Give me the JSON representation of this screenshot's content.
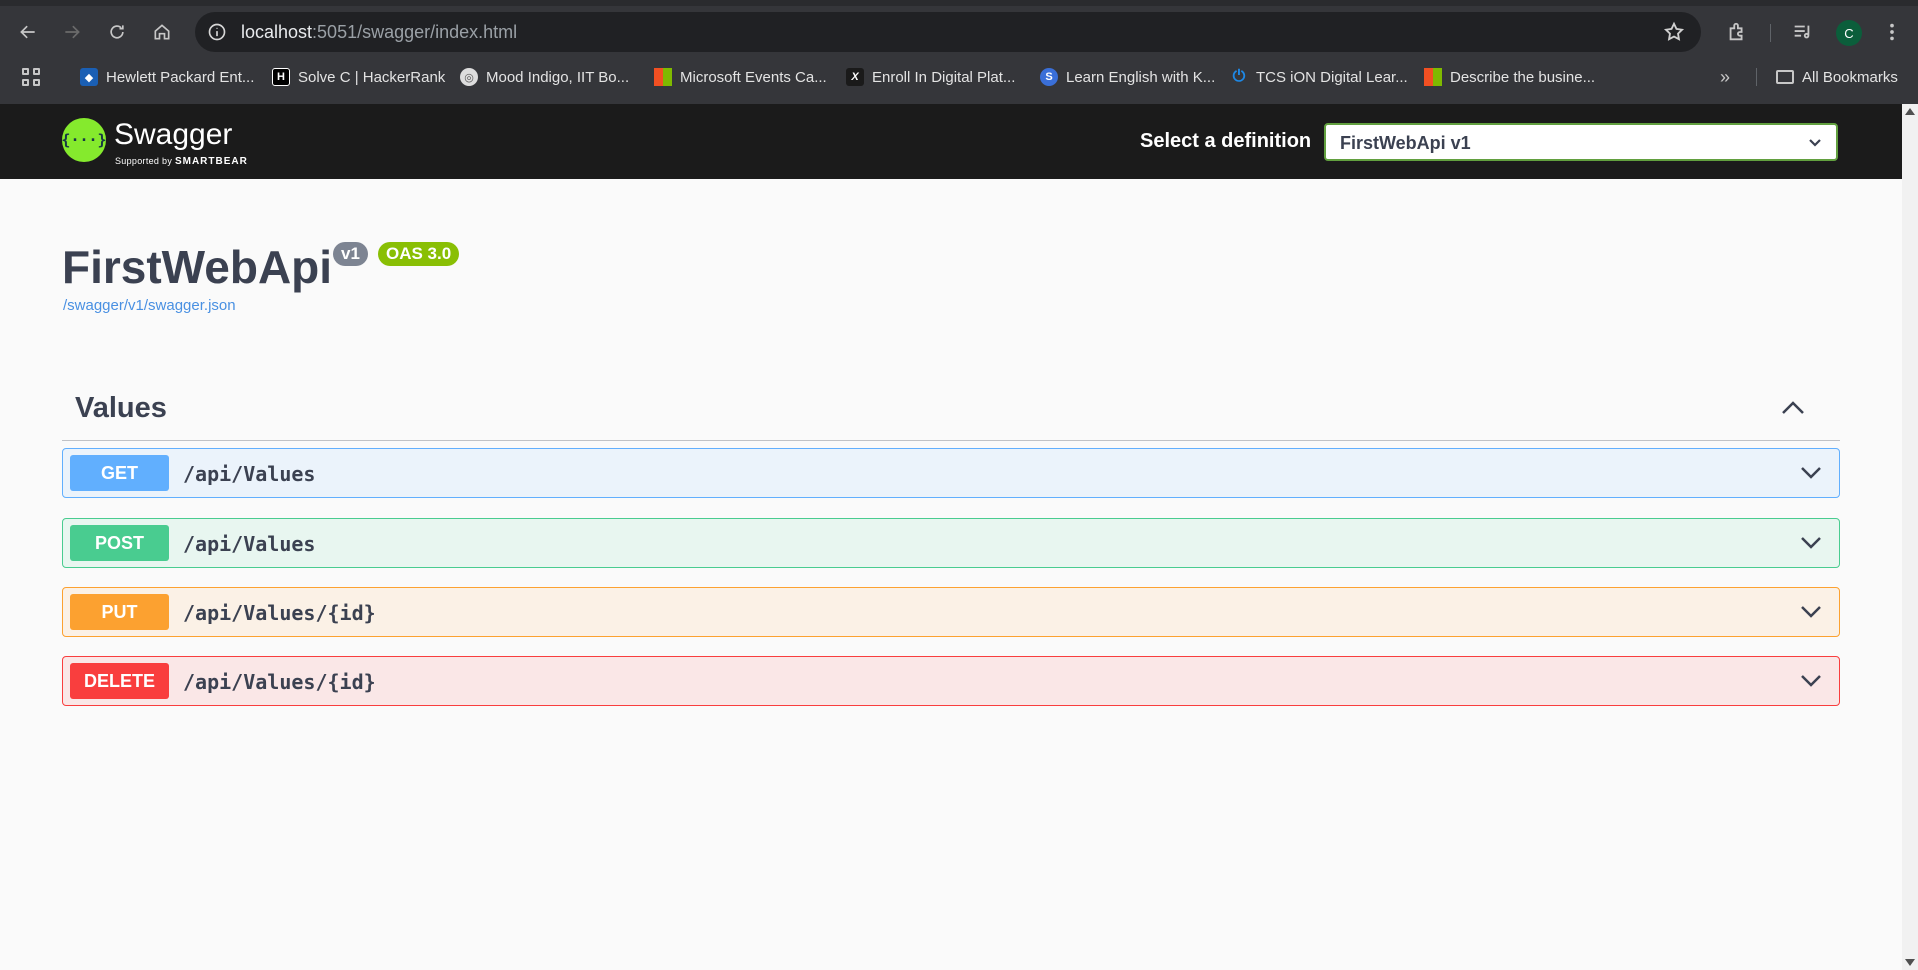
{
  "browser": {
    "url_host": "localhost",
    "url_rest": ":5051/swagger/index.html",
    "avatar_initial": "C",
    "bookmarks": [
      {
        "label": "Hewlett Packard Ent...",
        "icon": "hpe-icon",
        "color": "#1a5fb4"
      },
      {
        "label": "Solve C | HackerRank",
        "icon": "hackerrank-icon",
        "color": "#000000"
      },
      {
        "label": "Mood Indigo, IIT Bo...",
        "icon": "mood-indigo-icon",
        "color": "#dddddd"
      },
      {
        "label": "Microsoft Events Ca...",
        "icon": "microsoft-icon",
        "color": "#f25022"
      },
      {
        "label": "Enroll In Digital Plat...",
        "icon": "x-icon",
        "color": "#1a1a1a"
      },
      {
        "label": "Learn English with K...",
        "icon": "learn-english-icon",
        "color": "#3a6fd8"
      },
      {
        "label": "TCS iON Digital Lear...",
        "icon": "tcs-power-icon",
        "color": "#1e88e5"
      },
      {
        "label": "Describe the busine...",
        "icon": "microsoft-icon",
        "color": "#f25022"
      }
    ],
    "all_bookmarks_label": "All Bookmarks"
  },
  "topbar": {
    "logo_text": "Swagger",
    "logo_sub_prefix": "Supported by",
    "logo_sub_brand": "SMARTBEAR",
    "definition_label": "Select a definition",
    "definition_selected": "FirstWebApi v1"
  },
  "info": {
    "title": "FirstWebApi",
    "version_badge": "v1",
    "oas_badge": "OAS 3.0",
    "spec_link": "/swagger/v1/swagger.json"
  },
  "tag": {
    "name": "Values"
  },
  "operations": [
    {
      "method": "GET",
      "path": "/api/Values"
    },
    {
      "method": "POST",
      "path": "/api/Values"
    },
    {
      "method": "PUT",
      "path": "/api/Values/{id}"
    },
    {
      "method": "DELETE",
      "path": "/api/Values/{id}"
    }
  ],
  "colors": {
    "get": "#61affe",
    "post": "#49cc90",
    "put": "#fca130",
    "delete": "#f93e3e",
    "swagger_green": "#85ea2d"
  }
}
